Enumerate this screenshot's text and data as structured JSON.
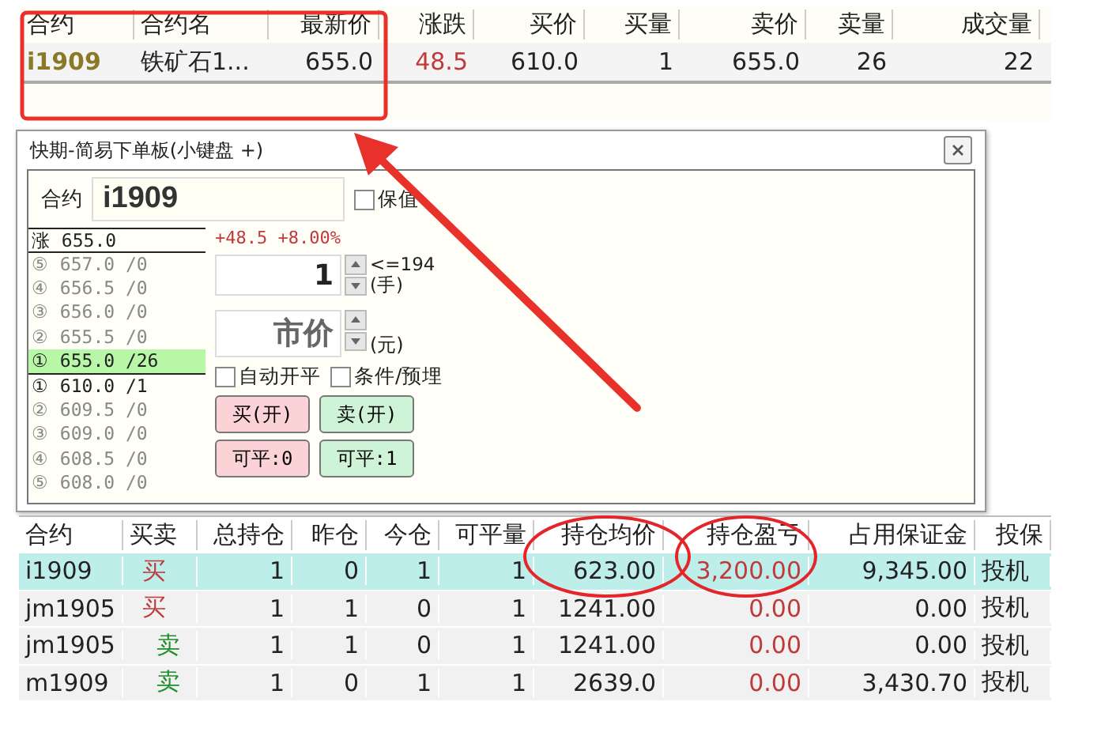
{
  "quote_table": {
    "columns": [
      "合约",
      "合约名",
      "最新价",
      "涨跌",
      "买价",
      "买量",
      "卖价",
      "卖量",
      "成交量"
    ],
    "rows": [
      {
        "cells": [
          "i1909",
          "铁矿石1...",
          "655.0",
          "48.5",
          "610.0",
          "1",
          "655.0",
          "26",
          "22"
        ]
      }
    ]
  },
  "order_panel": {
    "title": "快期-简易下单板(小键盘 +)",
    "contract_label": "合约",
    "contract_value": "i1909",
    "hedge_checkbox": {
      "label": "保值",
      "checked": false
    },
    "limit_up": "涨 655.0",
    "book": [
      {
        "text": "⑤ 657.0 /0",
        "selected": false,
        "emphasized": false
      },
      {
        "text": "④ 656.5 /0",
        "selected": false,
        "emphasized": false
      },
      {
        "text": "③ 656.0 /0",
        "selected": false,
        "emphasized": false
      },
      {
        "text": "② 655.5 /0",
        "selected": false,
        "emphasized": false
      },
      {
        "text": "① 655.0 /26",
        "selected": true,
        "emphasized": true
      },
      {
        "text": "① 610.0 /1",
        "selected": false,
        "emphasized": true
      },
      {
        "text": "② 609.5 /0",
        "selected": false,
        "emphasized": false
      },
      {
        "text": "③ 609.0 /0",
        "selected": false,
        "emphasized": false
      },
      {
        "text": "④ 608.5 /0",
        "selected": false,
        "emphasized": false
      },
      {
        "text": "⑤ 608.0 /0",
        "selected": false,
        "emphasized": false
      }
    ],
    "change_text": "+48.5 +8.00%",
    "quantity": {
      "value": "1",
      "max": "<=194",
      "unit": "(手)"
    },
    "price": {
      "value": "市价",
      "unit": "(元)"
    },
    "options": [
      {
        "label": "自动开平",
        "checked": false
      },
      {
        "label": "条件/预埋",
        "checked": false
      }
    ],
    "buttons": [
      {
        "label": "买(开)",
        "kind": "buy"
      },
      {
        "label": "卖(开)",
        "kind": "sell"
      },
      {
        "label": "可平:0",
        "kind": "buy"
      },
      {
        "label": "可平:1",
        "kind": "sell"
      }
    ]
  },
  "positions": {
    "columns": [
      "合约",
      "买卖",
      "总持仓",
      "昨仓",
      "今仓",
      "可平量",
      "持仓均价",
      "持仓盈亏",
      "占用保证金",
      "投保"
    ],
    "rows": [
      {
        "selected": true,
        "kind": "buy",
        "cells": [
          "i1909",
          "买",
          "1",
          "0",
          "1",
          "1",
          "623.00",
          "3,200.00",
          "9,345.00",
          "投机"
        ]
      },
      {
        "selected": false,
        "kind": "buy",
        "cells": [
          "jm1905",
          "买",
          "1",
          "1",
          "0",
          "1",
          "1241.00",
          "0.00",
          "0.00",
          "投机"
        ]
      },
      {
        "selected": false,
        "kind": "sell",
        "cells": [
          "jm1905",
          "卖",
          "1",
          "1",
          "0",
          "1",
          "1241.00",
          "0.00",
          "0.00",
          "投机"
        ]
      },
      {
        "selected": false,
        "kind": "sell",
        "cells": [
          "m1909",
          "卖",
          "1",
          "0",
          "1",
          "1",
          "2639.0",
          "0.00",
          "3,430.70",
          "投机"
        ]
      }
    ]
  }
}
